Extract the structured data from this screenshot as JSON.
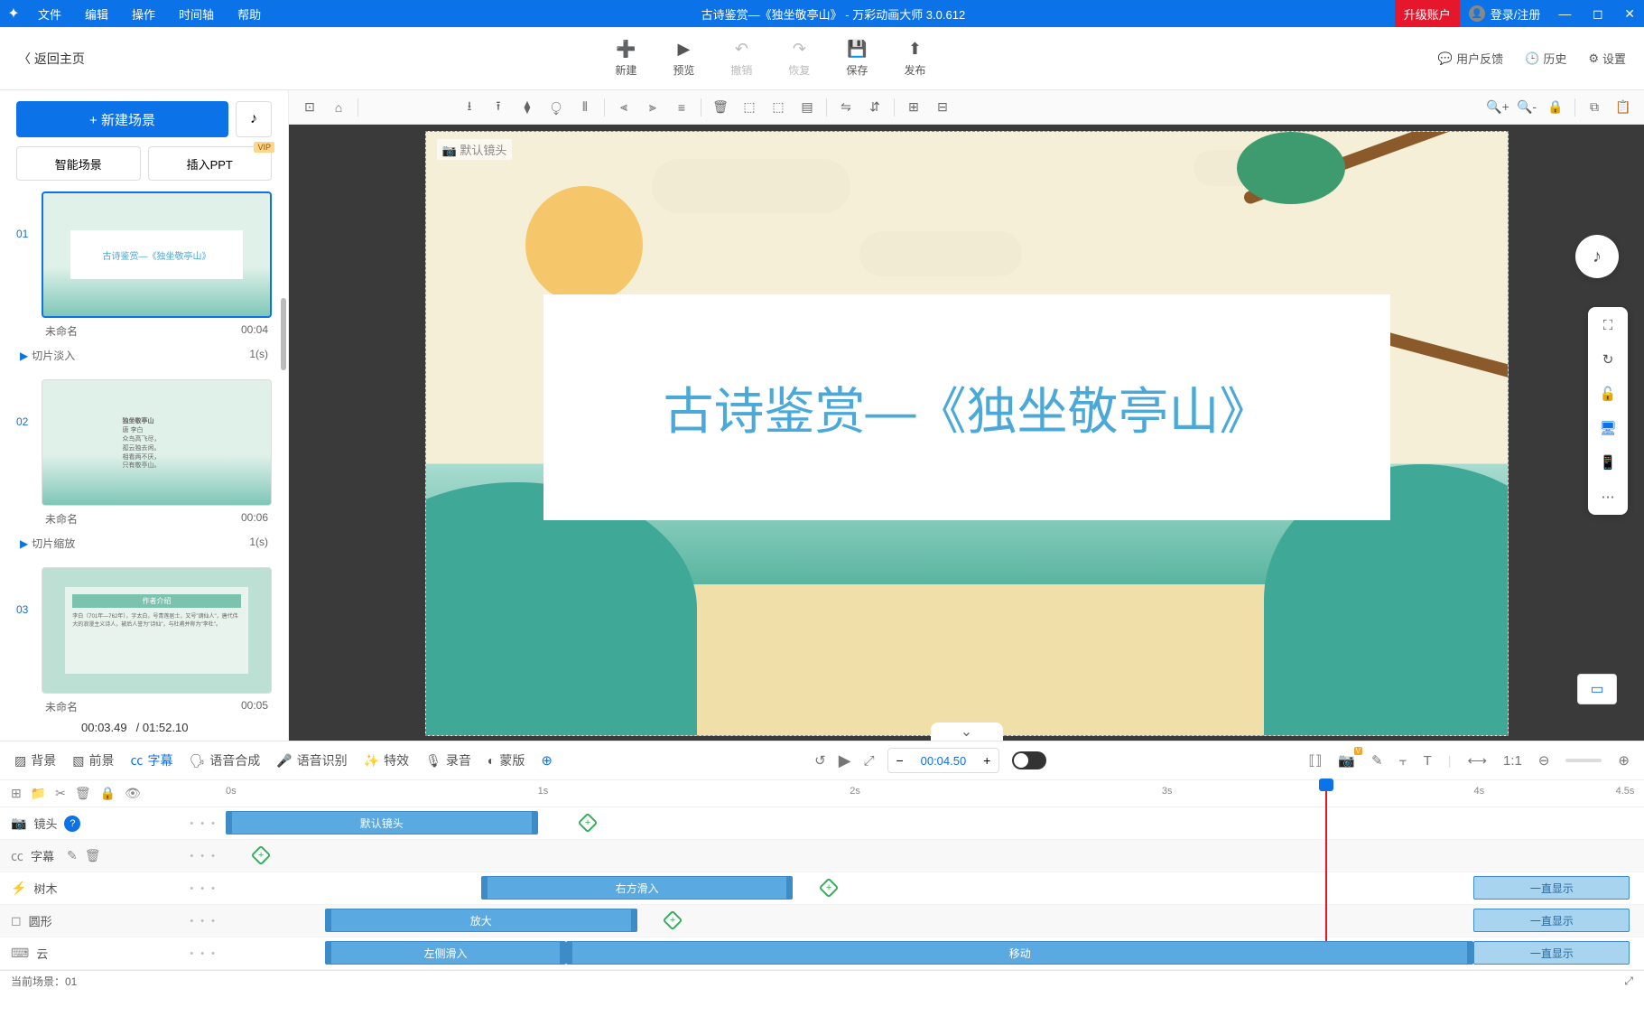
{
  "titlebar": {
    "menus": [
      "文件",
      "编辑",
      "操作",
      "时间轴",
      "帮助"
    ],
    "title": "古诗鉴赏—《独坐敬亭山》 - 万彩动画大师 3.0.612",
    "upgrade": "升级账户",
    "login": "登录/注册"
  },
  "toolbar": {
    "back": "返回主页",
    "new": "新建",
    "preview": "预览",
    "undo": "撤销",
    "redo": "恢复",
    "save": "保存",
    "publish": "发布",
    "feedback": "用户反馈",
    "history": "历史",
    "settings": "设置"
  },
  "sidebar": {
    "newscene": "+  新建场景",
    "smartscene": "智能场景",
    "insertppt": "插入PPT",
    "vip": "VIP",
    "scenes": [
      {
        "num": "01",
        "name": "未命名",
        "dur": "00:04",
        "thumb_title": "古诗鉴赏—《独坐敬亭山》",
        "trans": "切片淡入",
        "trans_dur": "1(s)"
      },
      {
        "num": "02",
        "name": "未命名",
        "dur": "00:06",
        "thumb_title": "独坐敬亭山",
        "poem": "唐 李白\n众鸟高飞尽，\n孤云独去闲。\n相看两不厌，\n只有敬亭山。",
        "trans": "切片缩放",
        "trans_dur": "1(s)"
      },
      {
        "num": "03",
        "name": "未命名",
        "dur": "00:05",
        "thumb_title": "作者介绍",
        "desc": "李白（701年—762年），字太白，号青莲居士，又号\"谪仙人\"，唐代伟大的浪漫主义诗人，被后人誉为\"诗仙\"，与杜甫并称为\"李杜\"。"
      }
    ],
    "cur_time": "00:03.49",
    "total_time": "/ 01:52.10"
  },
  "canvas": {
    "camera_label": "默认镜头",
    "title_text": "古诗鉴赏—《独坐敬亭山》"
  },
  "tl_toolbar": {
    "bg": "背景",
    "fg": "前景",
    "subtitle": "字幕",
    "tts": "语音合成",
    "asr": "语音识别",
    "fx": "特效",
    "record": "录音",
    "mask": "蒙版",
    "time": "00:04.50"
  },
  "timeline": {
    "ruler": [
      "0s",
      "1s",
      "2s",
      "3s",
      "4s",
      "4.5s"
    ],
    "tracks": {
      "camera": {
        "label": "镜头",
        "clip": "默认镜头"
      },
      "subtitle": {
        "label": "字幕"
      },
      "tree": {
        "label": "树木",
        "clip": "右方滑入",
        "tail": "一直显示"
      },
      "circle": {
        "label": "圆形",
        "clip": "放大",
        "tail": "一直显示"
      },
      "cloud": {
        "label": "云",
        "clip1": "左侧滑入",
        "clip2": "移动",
        "tail": "一直显示"
      }
    }
  },
  "statusbar": {
    "current": "当前场景：01"
  }
}
